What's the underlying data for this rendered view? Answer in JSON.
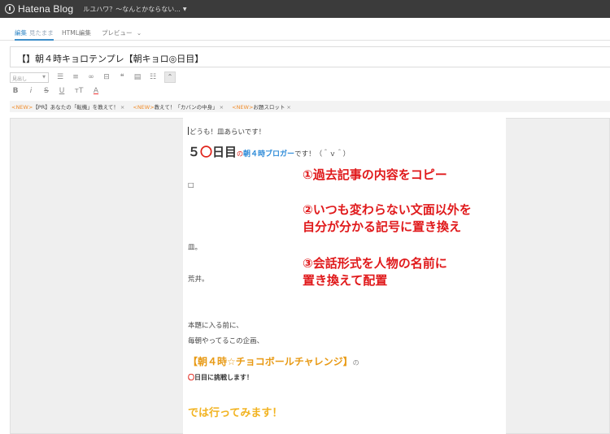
{
  "topbar": {
    "logo": "Hatena Blog",
    "blog_name": "ルユハワ？～なんとかならない..."
  },
  "tabs": [
    {
      "label": "編集",
      "sub": "見たまま"
    },
    {
      "label": "HTML編集"
    },
    {
      "label": "プレビュー"
    }
  ],
  "title": "【】朝４時キョロテンプレ【朝キョロ◎日目】",
  "toolbar": {
    "style_placeholder": "見出し",
    "bold": "B",
    "italic": "i",
    "strike": "S",
    "underline": "U",
    "size": "тT",
    "color": "A"
  },
  "tags": [
    {
      "new": "<NEW>",
      "text": "【PR】あなたの「転機」を教えて！",
      "x": "×"
    },
    {
      "new": "<NEW>",
      "text": "教えて！「カバンの中身」",
      "x": "×"
    },
    {
      "new": "<NEW>",
      "text": "お題スロット",
      "x": "×"
    }
  ],
  "content": {
    "greeting": "どうも！皿あらいです！",
    "fifty_num": "５",
    "fifty_circle": "〇",
    "fifty_day": "日目",
    "fifty_no": "の",
    "fifty_blogger": "朝４時ブロガー",
    "fifty_rest": "です！（＾ｖ＾）",
    "square": "□",
    "sara": "皿。",
    "arai": "荒井。",
    "intro1": "本題に入る前に、",
    "intro2": "毎朝やってるこの企画、",
    "challenge": "【朝４時☆チョコボールチャレンジ】",
    "challenge_no": "の",
    "attempt_circle": "〇",
    "attempt_text": "日目に挑戦します！",
    "letsgo": "では行ってみます！"
  },
  "annotations": {
    "a1": "①過去記事の内容をコピー",
    "a2_line1": "②いつも変わらない文面以外を",
    "a2_line2": "自分が分かる記号に置き換え",
    "a3_line1": "③会話形式を人物の名前に",
    "a3_line2": "置き換えて配置"
  }
}
